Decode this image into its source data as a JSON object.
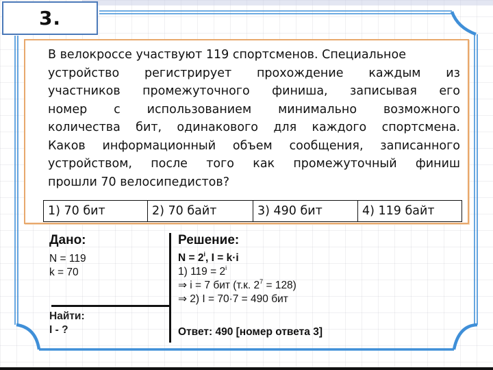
{
  "slide": {
    "number": "3.",
    "colors": {
      "frame_blue": "#3f8fd8",
      "task_border_orange": "#e8a86c",
      "number_box_border": "#4a78b8",
      "text": "#111111"
    }
  },
  "task": {
    "lines": [
      "В велокроссе участвуют 119 спортсменов. Специальное",
      "устройство регистрирует прохождение каждым из",
      "участников промежуточного финиша, записывая его",
      "номер с использованием минимально возможного",
      "количества бит, одинакового для каждого спортсмена.",
      "Каков информационный объем сообщения, записанного",
      "устройством, после того как промежуточный финиш",
      "прошли 70 велосипедистов?"
    ],
    "options": [
      "1) 70 бит",
      "2) 70 байт",
      "3) 490 бит",
      "4) 119 байт"
    ]
  },
  "given": {
    "heading": "Дано:",
    "values": [
      "N = 119",
      "k = 70"
    ]
  },
  "find": {
    "heading": "Найти:",
    "value": "I - ?"
  },
  "solution": {
    "heading": "Решение:",
    "formula_parts": {
      "a": "N = 2",
      "a_sup": "i",
      "b": ", I = k·i"
    },
    "step1": {
      "text": "1) 119 = 2",
      "sup": "i"
    },
    "step2": {
      "text": "⇒ i = 7 бит (т.к. 2",
      "sup": "7",
      "tail": " = 128)"
    },
    "step3": "⇒ 2) I = 70·7 = 490 бит",
    "answer": "Ответ: 490 [номер ответа 3]"
  }
}
